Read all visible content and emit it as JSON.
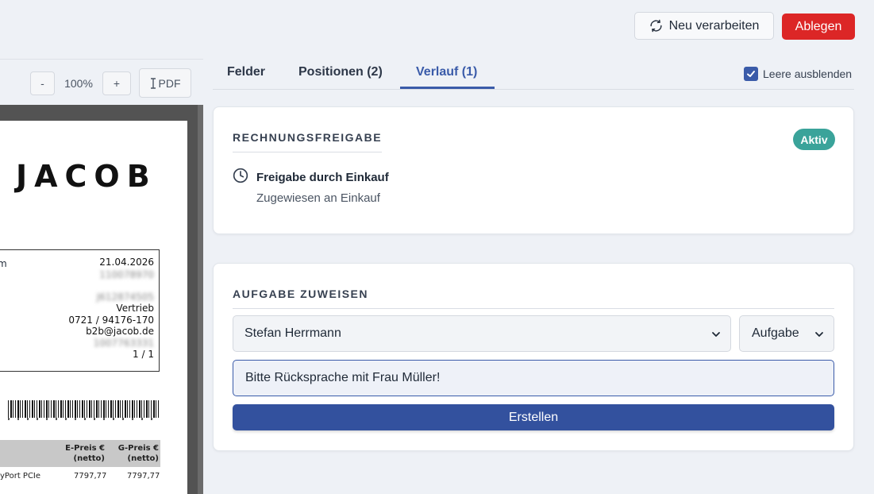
{
  "header": {
    "reprocess_label": "Neu verarbeiten",
    "file_label": "Ablegen"
  },
  "pdf_viewer": {
    "zoom_out_label": "-",
    "zoom_level": "100%",
    "zoom_in_label": "+",
    "pdf_button_label": "PDF",
    "document": {
      "logo_text": "JACOB",
      "date": "21.04.2026",
      "left_fragment": "m",
      "blurred_1": "110078970",
      "blurred_2": "J612874505",
      "department": "Vertrieb",
      "phone": "0721 / 94176-170",
      "email": "b2b@jacob.de",
      "blurred_3": "1007763331",
      "page": "1 / 1",
      "col_unit_price": "E-Preis €\n(netto)",
      "col_total_price": "G-Preis €\n(netto)",
      "row_desc": "yPort PCIe",
      "row_unit_price": "7797,77",
      "row_total_price": "7797,77"
    }
  },
  "tabs": [
    {
      "label": "Felder"
    },
    {
      "label": "Positionen (2)"
    },
    {
      "label": "Verlauf (1)"
    }
  ],
  "active_tab": "Verlauf (1)",
  "hide_empty": {
    "label": "Leere ausblenden",
    "checked": true
  },
  "approval_card": {
    "title": "RECHNUNGSFREIGABE",
    "status_badge": "Aktiv",
    "step_title": "Freigabe durch Einkauf",
    "step_subtitle": "Zugewiesen an Einkauf"
  },
  "assign_card": {
    "title": "AUFGABE ZUWEISEN",
    "user_select_value": "Stefan Herrmann",
    "type_select_value": "Aufgabe",
    "note_value": "Bitte Rücksprache mit Frau Müller!",
    "create_label": "Erstellen"
  },
  "colors": {
    "accent": "#3a5ba9",
    "danger": "#dc2626",
    "badge": "#3aa39a",
    "primary_button": "#33519e"
  }
}
